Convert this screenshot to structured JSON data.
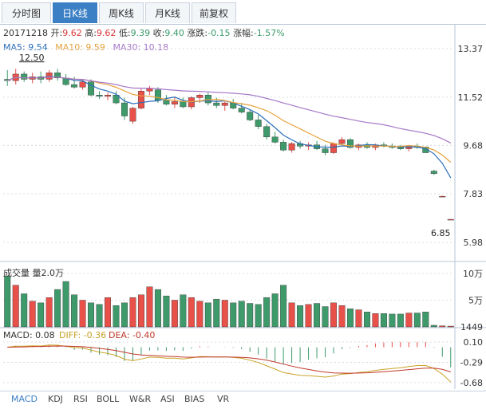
{
  "tabs": [
    {
      "label": "分时图"
    },
    {
      "label": "日K线",
      "active": true
    },
    {
      "label": "周K线"
    },
    {
      "label": "月K线"
    },
    {
      "label": "前复权"
    }
  ],
  "info": {
    "date": "20171218",
    "open_label": "开:",
    "open": "9.62",
    "high_label": "高:",
    "high": "9.62",
    "low_label": "低:",
    "low": "9.39",
    "close_label": "收:",
    "close": "9.40",
    "change_label": "涨跌:",
    "change": "-0.15",
    "pct_label": "涨幅:",
    "pct": "-1.57%"
  },
  "ma": {
    "ma5": "MA5: 9.54",
    "ma10": "MA10: 9.59",
    "ma30": "MA30: 10.18",
    "ma5_color": "#2a6ebb",
    "ma10_color": "#e6a23c",
    "ma30_color": "#a678c8"
  },
  "volume_label": "成交量 量2.0万",
  "macd_label": {
    "macd": "MACD: 0.08",
    "diff": "DIFF: -0.36",
    "dea": "DEA: -0.40"
  },
  "bottom_tabs": [
    {
      "label": "MACD",
      "active": true
    },
    {
      "label": "KDJ"
    },
    {
      "label": "RSI"
    },
    {
      "label": "BOLL"
    },
    {
      "label": "W&R"
    },
    {
      "label": "ASI"
    },
    {
      "label": "BIAS"
    },
    {
      "label": "VR"
    }
  ],
  "colors": {
    "up": "#e8504a",
    "down": "#3f9a6b",
    "grid": "#d8dde3"
  },
  "chart_data": [
    {
      "type": "candlestick",
      "y_axis_labels": [
        "13.37",
        "11.52",
        "9.68",
        "7.83",
        "5.98"
      ],
      "ylim": [
        5.98,
        13.37
      ],
      "annotations": {
        "high": "12.50",
        "low": "6.85"
      },
      "candles": [
        [
          12.2,
          12.55,
          11.95,
          12.15
        ],
        [
          12.15,
          12.6,
          12.0,
          12.4
        ],
        [
          12.4,
          12.5,
          12.1,
          12.2
        ],
        [
          12.2,
          12.45,
          12.05,
          12.3
        ],
        [
          12.3,
          12.5,
          12.05,
          12.2
        ],
        [
          12.2,
          12.55,
          12.1,
          12.45
        ],
        [
          12.45,
          12.6,
          12.15,
          12.25
        ],
        [
          12.25,
          12.4,
          11.95,
          12.0
        ],
        [
          12.0,
          12.3,
          11.85,
          11.9
        ],
        [
          11.9,
          12.2,
          11.8,
          12.1
        ],
        [
          12.1,
          12.2,
          11.55,
          11.6
        ],
        [
          11.6,
          11.75,
          11.45,
          11.55
        ],
        [
          11.55,
          11.7,
          11.4,
          11.6
        ],
        [
          11.6,
          11.75,
          11.25,
          11.3
        ],
        [
          11.3,
          11.5,
          10.65,
          10.8
        ],
        [
          10.6,
          11.15,
          10.5,
          11.1
        ],
        [
          11.1,
          11.85,
          11.05,
          11.75
        ],
        [
          11.75,
          11.95,
          11.6,
          11.85
        ],
        [
          11.8,
          11.9,
          11.3,
          11.4
        ],
        [
          11.4,
          11.6,
          11.2,
          11.25
        ],
        [
          11.25,
          11.5,
          11.1,
          11.35
        ],
        [
          11.35,
          11.5,
          11.1,
          11.15
        ],
        [
          11.15,
          11.55,
          11.05,
          11.5
        ],
        [
          11.5,
          11.65,
          11.3,
          11.6
        ],
        [
          11.6,
          11.7,
          11.2,
          11.3
        ],
        [
          11.3,
          11.5,
          11.1,
          11.2
        ],
        [
          11.2,
          11.35,
          11.0,
          11.3
        ],
        [
          11.3,
          11.45,
          11.05,
          11.1
        ],
        [
          11.1,
          11.3,
          10.9,
          10.95
        ],
        [
          10.95,
          11.05,
          10.6,
          10.65
        ],
        [
          10.65,
          10.85,
          10.3,
          10.4
        ],
        [
          10.4,
          10.5,
          9.9,
          10.0
        ],
        [
          10.0,
          10.2,
          9.75,
          9.8
        ],
        [
          9.8,
          9.9,
          9.45,
          9.5
        ],
        [
          9.5,
          9.8,
          9.4,
          9.75
        ],
        [
          9.75,
          9.85,
          9.55,
          9.65
        ],
        [
          9.65,
          9.8,
          9.5,
          9.7
        ],
        [
          9.7,
          9.85,
          9.5,
          9.55
        ],
        [
          9.55,
          9.7,
          9.3,
          9.4
        ],
        [
          9.4,
          9.8,
          9.35,
          9.75
        ],
        [
          9.75,
          10.0,
          9.7,
          9.9
        ],
        [
          9.9,
          9.95,
          9.55,
          9.6
        ],
        [
          9.6,
          9.75,
          9.5,
          9.7
        ],
        [
          9.7,
          9.8,
          9.55,
          9.6
        ],
        [
          9.6,
          9.75,
          9.5,
          9.7
        ],
        [
          9.7,
          9.8,
          9.6,
          9.65
        ],
        [
          9.65,
          9.75,
          9.55,
          9.6
        ],
        [
          9.6,
          9.7,
          9.5,
          9.55
        ],
        [
          9.55,
          9.7,
          9.45,
          9.65
        ],
        [
          9.65,
          9.75,
          9.55,
          9.6
        ],
        [
          9.62,
          9.62,
          9.39,
          9.4
        ],
        [
          8.7,
          8.75,
          8.55,
          8.6
        ],
        [
          7.74,
          7.76,
          7.72,
          7.74
        ],
        [
          6.85,
          6.87,
          6.83,
          6.86
        ]
      ]
    },
    {
      "type": "bar",
      "title": "成交量",
      "y_axis_labels": [
        "10万",
        "5万",
        "1449"
      ],
      "ylim": [
        0,
        100000
      ],
      "values": [
        95000,
        78000,
        62000,
        48000,
        45000,
        55000,
        70000,
        85000,
        60000,
        50000,
        45000,
        42000,
        55000,
        40000,
        45000,
        55000,
        60000,
        75000,
        70000,
        58000,
        50000,
        60000,
        55000,
        48000,
        45000,
        52000,
        50000,
        45000,
        48000,
        44000,
        42000,
        55000,
        62000,
        78000,
        45000,
        40000,
        42000,
        44000,
        38000,
        45000,
        40000,
        34000,
        32000,
        28000,
        25000,
        25000,
        24000,
        24000,
        26000,
        26000,
        28000,
        3000,
        2000,
        1449
      ]
    },
    {
      "type": "line",
      "title": "MACD",
      "y_axis_labels": [
        "0.10",
        "-0.29",
        "-0.68"
      ],
      "ylim": [
        -0.68,
        0.1
      ]
    }
  ]
}
